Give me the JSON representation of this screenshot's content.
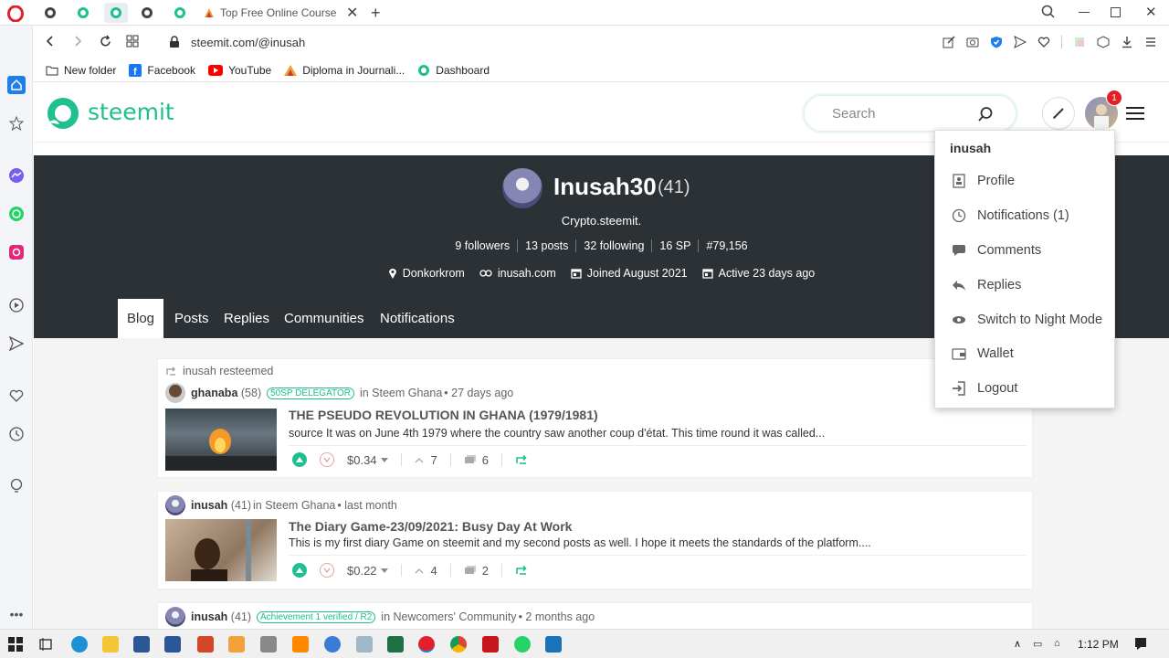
{
  "browser": {
    "tab_active_title": "Top Free Online Courses | E",
    "url": "steemit.com/@inusah",
    "bookmarks": [
      {
        "label": "New folder",
        "icon": "folder-icon"
      },
      {
        "label": "Facebook",
        "icon": "facebook-icon"
      },
      {
        "label": "YouTube",
        "icon": "youtube-icon"
      },
      {
        "label": "Diploma in Journali...",
        "icon": "alison-icon"
      },
      {
        "label": "Dashboard",
        "icon": "dashboard-icon"
      }
    ]
  },
  "header": {
    "logo_text": "steemit",
    "search_placeholder": "Search",
    "notification_count": "1"
  },
  "profile": {
    "name": "Inusah30",
    "reputation": "(41)",
    "about": "Crypto.steemit.",
    "stats": [
      "9 followers",
      "13 posts",
      "32 following",
      "16 SP",
      "#79,156"
    ],
    "location": "Donkorkrom",
    "website": "inusah.com",
    "joined": "Joined August 2021",
    "active": "Active 23 days ago"
  },
  "tabs": [
    "Blog",
    "Posts",
    "Replies",
    "Communities",
    "Notifications"
  ],
  "posts": [
    {
      "resteem_label": "inusah resteemed",
      "author": "ghanaba",
      "rep": "(58)",
      "badge": "50SP DELEGATOR",
      "community": "in Steem Ghana",
      "time": "• 27 days ago",
      "title": "THE PSEUDO REVOLUTION IN GHANA (1979/1981)",
      "body": "source It was on June 4th 1979 where the country saw another coup d'état. This time round it was called...",
      "payout": "$0.34",
      "votes": "7",
      "comments": "6"
    },
    {
      "author": "inusah",
      "rep": "(41)",
      "community": "in Steem Ghana",
      "time": "• last month",
      "title": "The Diary Game-23/09/2021: Busy Day At Work",
      "body": "This is my first diary Game on steemit and my second posts as well. I hope it meets the standards of the platform....",
      "payout": "$0.22",
      "votes": "4",
      "comments": "2"
    },
    {
      "author": "inusah",
      "rep": "(41)",
      "badge": "Achievement 1 verified / R2",
      "community": "in Newcomers' Community",
      "time": "• 2 months ago"
    }
  ],
  "dropdown": {
    "username": "inusah",
    "items": [
      {
        "label": "Profile",
        "icon": "profile-icon"
      },
      {
        "label": "Notifications (1)",
        "icon": "clock-icon"
      },
      {
        "label": "Comments",
        "icon": "comment-icon"
      },
      {
        "label": "Replies",
        "icon": "reply-icon"
      },
      {
        "label": "Switch to Night Mode",
        "icon": "eye-icon"
      },
      {
        "label": "Wallet",
        "icon": "wallet-icon"
      },
      {
        "label": "Logout",
        "icon": "logout-icon"
      }
    ]
  },
  "taskbar": {
    "time": "1:12 PM"
  },
  "colors": {
    "brand": "#1fbf8f",
    "banner": "#2c3136",
    "badge": "#e21f26"
  }
}
